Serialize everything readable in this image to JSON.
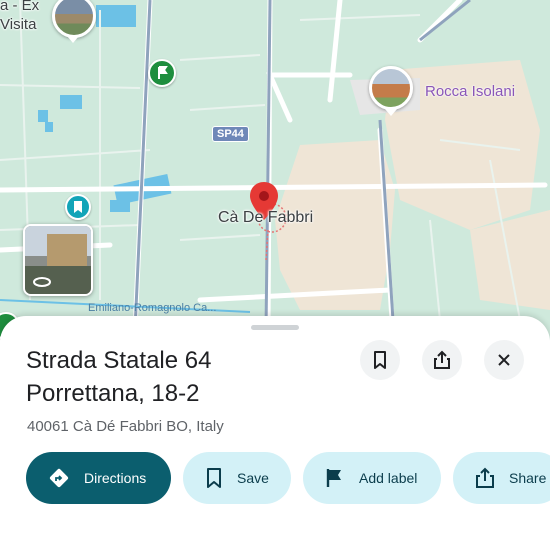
{
  "map": {
    "labels": {
      "top_left_line1": "a - Ex",
      "top_left_line2": "Visita",
      "road_shield": "SP44",
      "town": "Cà De Fabbri",
      "poi_right": "Rocca Isolani",
      "canal": "Emiliano-Romagnolo Ca..."
    }
  },
  "sheet": {
    "title_line1": "Strada Statale 64",
    "title_line2": "Porrettana, 18-2",
    "address": "40061 Cà Dé Fabbri BO, Italy",
    "actions": {
      "directions": "Directions",
      "save": "Save",
      "add_label": "Add label",
      "share": "Share"
    }
  },
  "colors": {
    "accent": "#0b5e6e",
    "pill_bg": "#d3f1f7",
    "pin_red": "#e53935"
  }
}
